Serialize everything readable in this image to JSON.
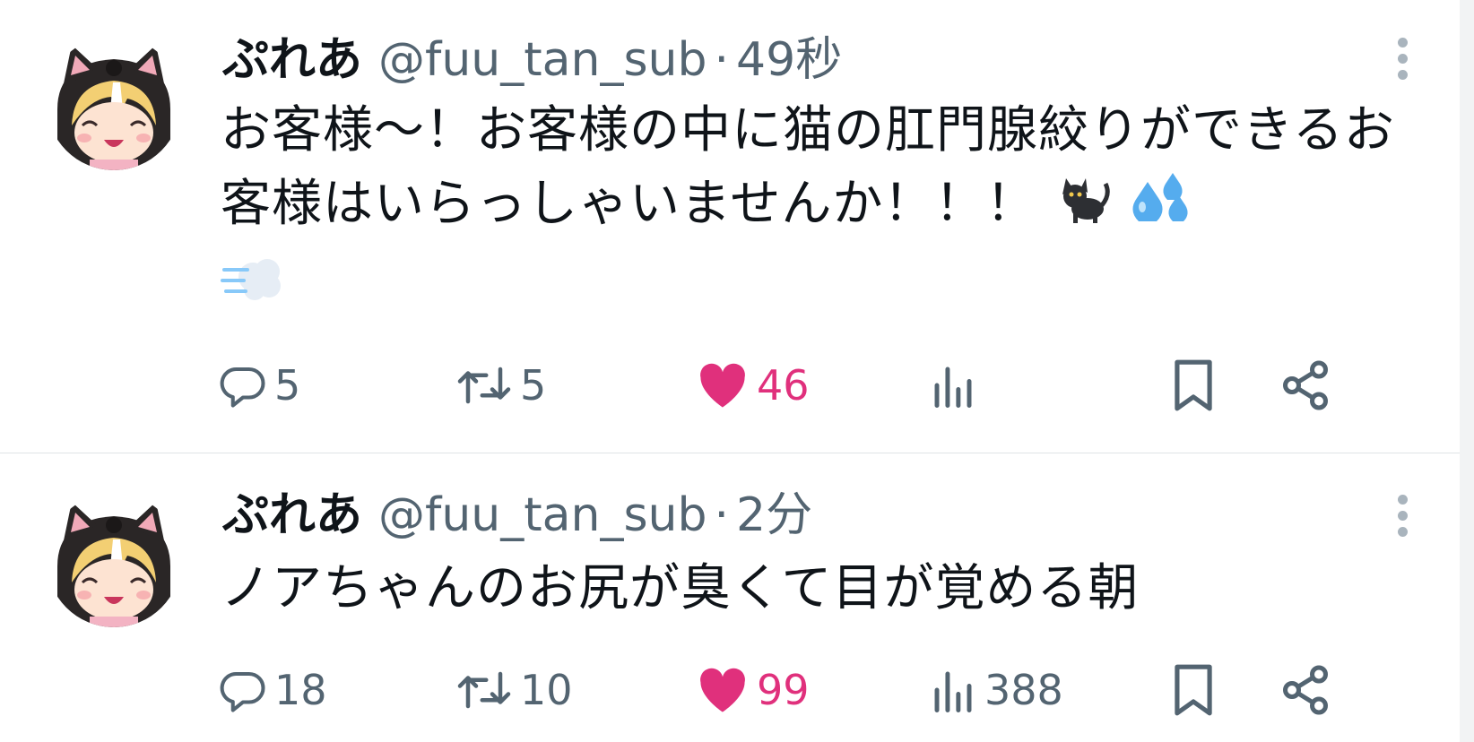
{
  "tweets": [
    {
      "display_name": "ぷれあ",
      "handle": "@fuu_tan_sub",
      "separator": "·",
      "time": "49秒",
      "text": "お客様〜！お客様の中に猫の肛門腺絞りができるお客様はいらっしゃいませんか！！！",
      "emojis": [
        "black-cat",
        "sweat-droplets",
        "dashing-away"
      ],
      "replies": "5",
      "retweets": "5",
      "likes": "46",
      "liked": true,
      "views": ""
    },
    {
      "display_name": "ぷれあ",
      "handle": "@fuu_tan_sub",
      "separator": "·",
      "time": "2分",
      "text": "ノアちゃんのお尻が臭くて目が覚める朝",
      "emojis": [],
      "replies": "18",
      "retweets": "10",
      "likes": "99",
      "liked": true,
      "views": "388"
    }
  ],
  "colors": {
    "text_primary": "#0f1419",
    "text_secondary": "#536471",
    "like": "#e0307c",
    "divider": "#dfe3e6"
  }
}
